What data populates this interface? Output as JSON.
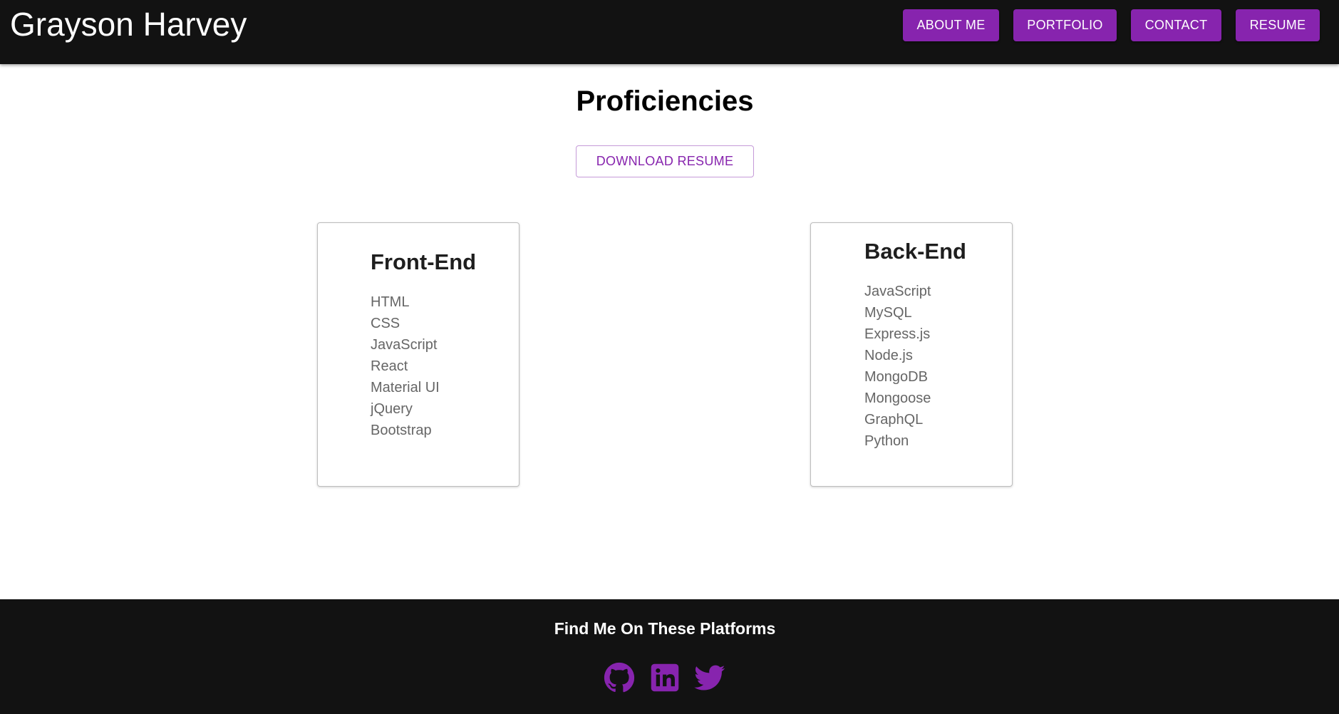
{
  "header": {
    "brand": "Grayson Harvey",
    "nav": [
      {
        "label": "ABOUT ME"
      },
      {
        "label": "PORTFOLIO"
      },
      {
        "label": "CONTACT"
      },
      {
        "label": "RESUME"
      }
    ]
  },
  "main": {
    "title": "Proficiencies",
    "download_label": "DOWNLOAD RESUME",
    "cards": [
      {
        "title": "Front-End",
        "items": [
          "HTML",
          "CSS",
          "JavaScript",
          "React",
          "Material UI",
          "jQuery",
          "Bootstrap"
        ]
      },
      {
        "title": "Back-End",
        "items": [
          "JavaScript",
          "MySQL",
          "Express.js",
          "Node.js",
          "MongoDB",
          "Mongoose",
          "GraphQL",
          "Python"
        ]
      }
    ]
  },
  "footer": {
    "title": "Find Me On These Platforms",
    "icons": [
      "github-icon",
      "linkedin-icon",
      "twitter-icon"
    ]
  },
  "colors": {
    "accent": "#8724ae",
    "header_bg": "#121212",
    "footer_bg": "#121212"
  }
}
